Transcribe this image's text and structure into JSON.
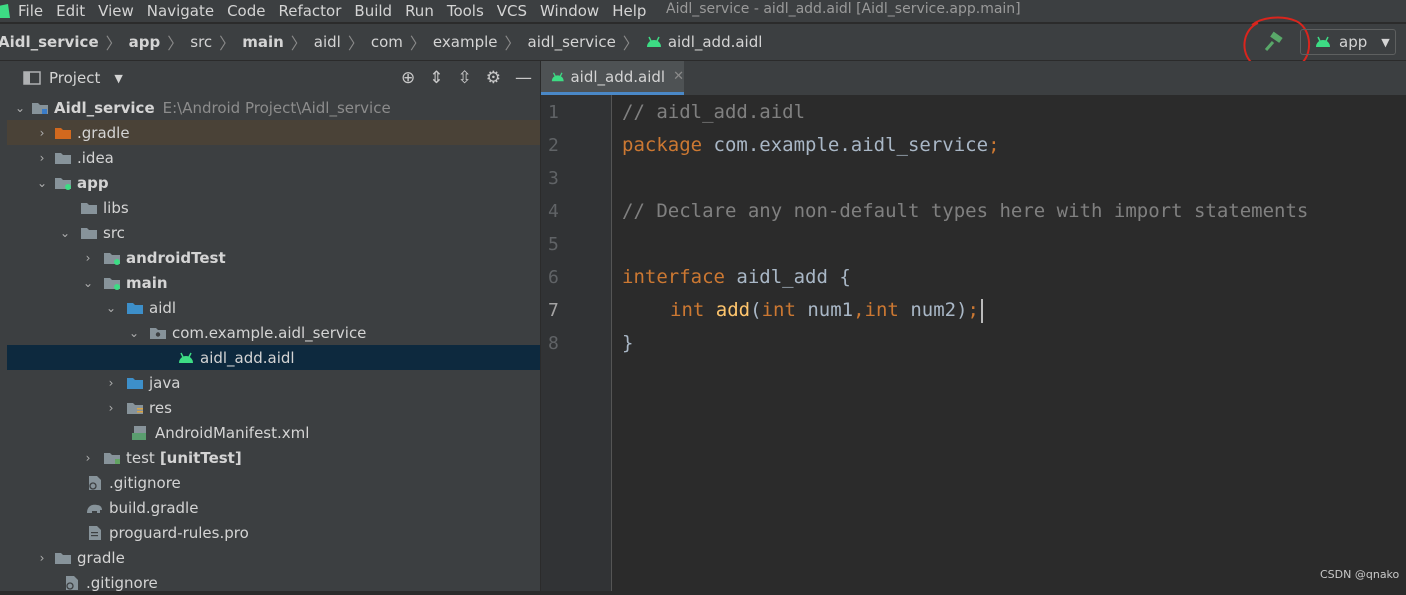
{
  "menu": {
    "items": [
      "File",
      "Edit",
      "View",
      "Navigate",
      "Code",
      "Refactor",
      "Build",
      "Run",
      "Tools",
      "VCS",
      "Window",
      "Help"
    ],
    "window_title": "Aidl_service - aidl_add.aidl [Aidl_service.app.main]"
  },
  "breadcrumbs": [
    "Aidl_service",
    "app",
    "src",
    "main",
    "aidl",
    "com",
    "example",
    "aidl_service",
    "aidl_add.aidl"
  ],
  "run_config": {
    "label": "app"
  },
  "project_panel": {
    "title": "Project",
    "tree": [
      {
        "label": "Aidl_service",
        "hint": "E:\\Android Project\\Aidl_service"
      },
      {
        "label": ".gradle"
      },
      {
        "label": ".idea"
      },
      {
        "label": "app"
      },
      {
        "label": "libs"
      },
      {
        "label": "src"
      },
      {
        "label": "androidTest"
      },
      {
        "label": "main"
      },
      {
        "label": "aidl"
      },
      {
        "label": "com.example.aidl_service"
      },
      {
        "label": "aidl_add.aidl"
      },
      {
        "label": "java"
      },
      {
        "label": "res"
      },
      {
        "label": "AndroidManifest.xml"
      },
      {
        "label": "test",
        "hint": "[unitTest]"
      },
      {
        "label": ".gitignore"
      },
      {
        "label": "build.gradle"
      },
      {
        "label": "proguard-rules.pro"
      },
      {
        "label": "gradle"
      },
      {
        "label": ".gitignore"
      }
    ]
  },
  "editor": {
    "tab_label": "aidl_add.aidl",
    "line_numbers": [
      "1",
      "2",
      "3",
      "4",
      "5",
      "6",
      "7",
      "8"
    ],
    "lines": [
      {
        "text": "// aidl_add.aidl"
      },
      {
        "kw": "package",
        "rest": " com.example.aidl_service",
        "semi": ";"
      },
      {
        "text": ""
      },
      {
        "text": "// Declare any non-default types here with import statements"
      },
      {
        "text": ""
      },
      {
        "kw": "interface",
        "rest": " aidl_add {"
      },
      {
        "ret": "int",
        "fn": "add",
        "paren_open": "(",
        "t1": "int",
        "a1": " num1",
        "comma": ",",
        "t2": "int",
        "a2": " num2",
        "paren_close": ")",
        "semi": ";"
      },
      {
        "text": "}"
      }
    ]
  },
  "watermark": "CSDN @qnako",
  "colors": {
    "accent": "#4a88c7",
    "android_green": "#3ddc84",
    "annotation_red": "#d9251d"
  }
}
